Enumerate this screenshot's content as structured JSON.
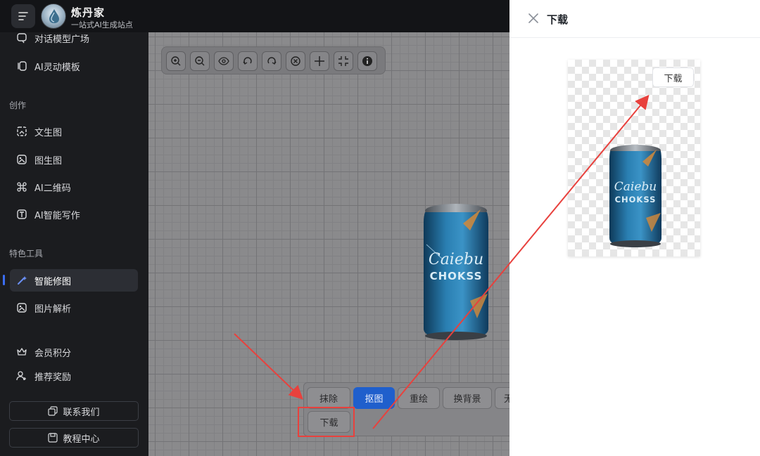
{
  "app": {
    "brand_name": "炼丹家",
    "brand_subtitle": "一站式AI生成站点"
  },
  "sidebar": {
    "items_top": [
      {
        "label": "对话模型广场",
        "icon": "chat-bubble-icon"
      },
      {
        "label": "AI灵动模板",
        "icon": "layers-icon"
      }
    ],
    "section_create": "创作",
    "items_create": [
      {
        "label": "文生图",
        "icon": "text-to-image-icon"
      },
      {
        "label": "图生图",
        "icon": "image-to-image-icon"
      },
      {
        "label": "AI二维码",
        "icon": "qrcode-icon"
      },
      {
        "label": "AI智能写作",
        "icon": "text-box-icon"
      }
    ],
    "section_tools": "特色工具",
    "items_tools": [
      {
        "label": "智能修图",
        "icon": "magic-wand-icon",
        "active": true
      },
      {
        "label": "图片解析",
        "icon": "image-parse-icon"
      }
    ],
    "items_bottom": [
      {
        "label": "会员积分",
        "icon": "crown-icon"
      },
      {
        "label": "推荐奖励",
        "icon": "user-add-icon"
      }
    ],
    "contact_button": "联系我们",
    "tutorial_button": "教程中心"
  },
  "toolbar": {
    "tools": [
      "zoom-in-icon",
      "zoom-out-icon",
      "eye-icon",
      "undo-icon",
      "redo-icon",
      "clear-icon",
      "move-icon",
      "fit-screen-icon",
      "info-icon"
    ]
  },
  "actions": {
    "items": [
      {
        "label": "抹除",
        "active": false
      },
      {
        "label": "抠图",
        "active": true
      },
      {
        "label": "重绘",
        "active": false
      },
      {
        "label": "换背景",
        "active": false
      },
      {
        "label": "无",
        "active": false
      }
    ],
    "download_label": "下载"
  },
  "product": {
    "can_text_1": "Caiebu",
    "can_text_2": "CHOKSS"
  },
  "drawer": {
    "title": "下载",
    "preview_download_label": "下载"
  },
  "colors": {
    "accent": "#1f5fcc",
    "sidebar_bg": "#1b1c1f",
    "annotation_red": "#e8413d"
  }
}
